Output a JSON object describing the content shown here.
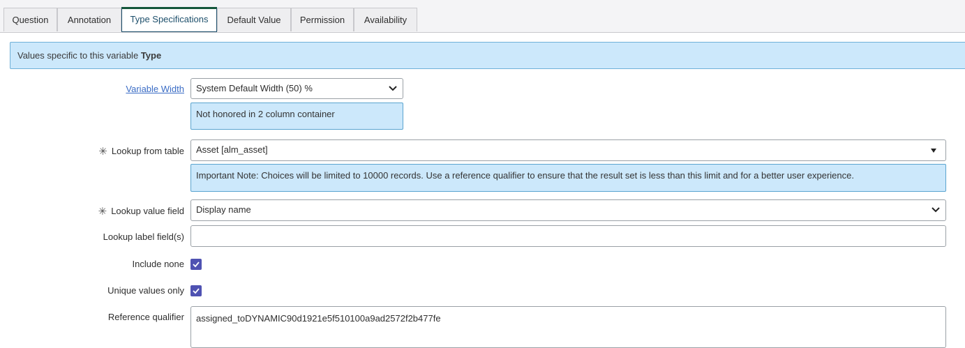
{
  "tabs": [
    {
      "label": "Question"
    },
    {
      "label": "Annotation"
    },
    {
      "label": "Type Specifications"
    },
    {
      "label": "Default Value"
    },
    {
      "label": "Permission"
    },
    {
      "label": "Availability"
    }
  ],
  "active_tab": "Type Specifications",
  "banner": {
    "text": "Values specific to this variable",
    "emphasis": "Type"
  },
  "fields": {
    "variable_width": {
      "label": "Variable Width",
      "value": "System Default Width (50) %",
      "note": "Not honored in 2 column container"
    },
    "lookup_from_table": {
      "label": "Lookup from table",
      "value": "Asset [alm_asset]",
      "note": "Important Note: Choices will be limited to 10000 records. Use a reference qualifier to ensure that the result set is less than this limit and for a better user experience."
    },
    "lookup_value_field": {
      "label": "Lookup value field",
      "value": "Display name"
    },
    "lookup_label_fields": {
      "label": "Lookup label field(s)",
      "value": ""
    },
    "include_none": {
      "label": "Include none",
      "checked": true
    },
    "unique_values_only": {
      "label": "Unique values only",
      "checked": true
    },
    "reference_qualifier": {
      "label": "Reference qualifier",
      "value": "assigned_toDYNAMIC90d1921e5f510100a9ad2572f2b477fe"
    }
  },
  "colors": {
    "accent": "#4f52b2",
    "info_bg": "#cce8fb",
    "info_border": "#6fb0d8",
    "link": "#3a6cc5",
    "active_tab_top": "#14573b"
  }
}
